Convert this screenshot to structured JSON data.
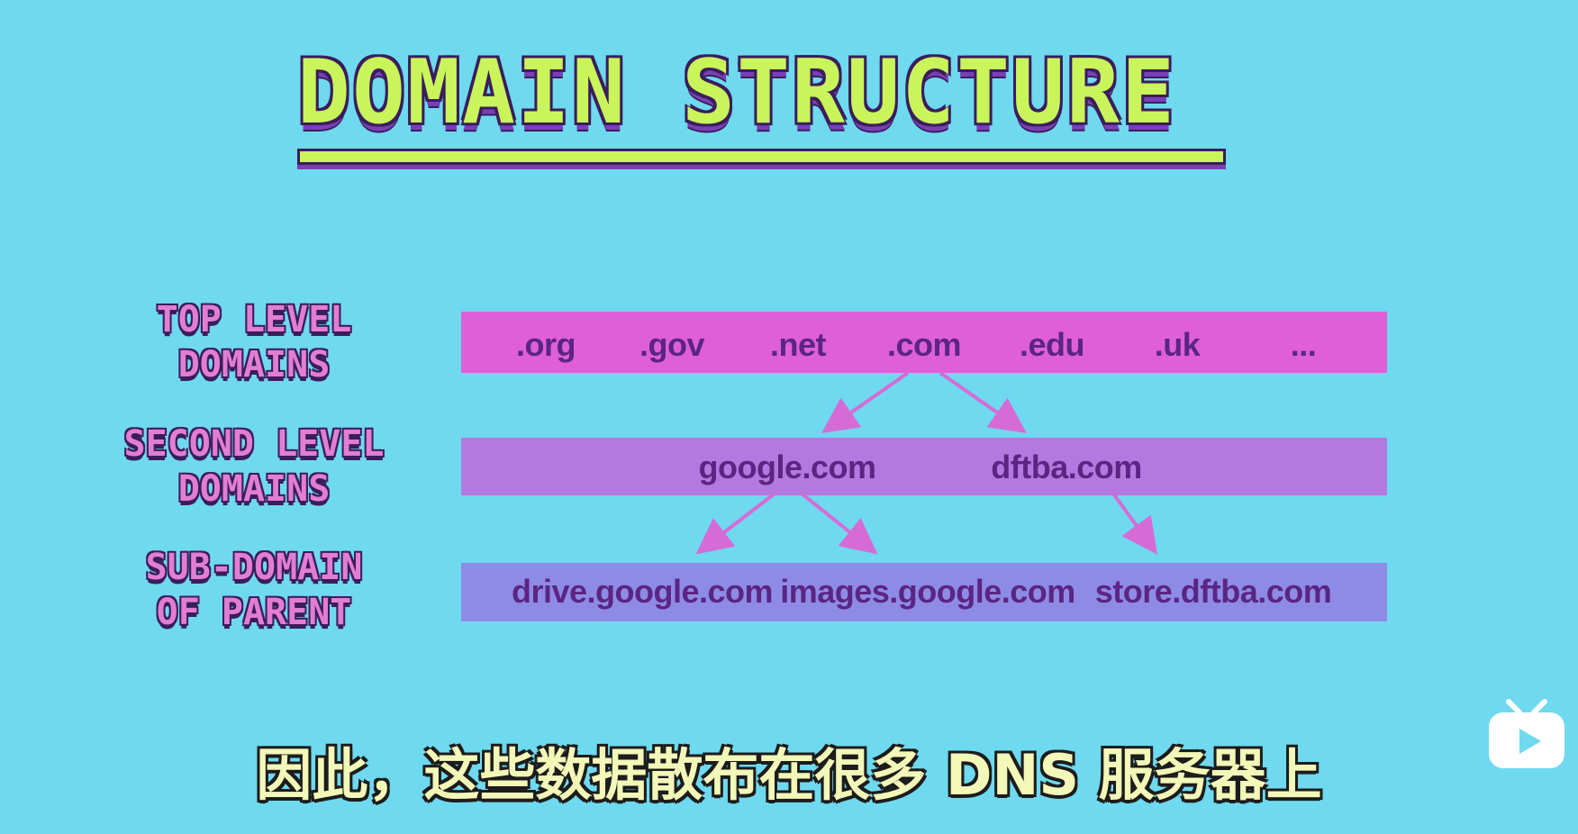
{
  "title": "DOMAIN STRUCTURE",
  "levels": {
    "top": {
      "line1": "TOP LEVEL",
      "line2": "DOMAINS"
    },
    "second": {
      "line1": "SECOND LEVEL",
      "line2": "DOMAINS"
    },
    "sub": {
      "line1": "SUB-DOMAIN",
      "line2": "OF PARENT"
    }
  },
  "top_level_domains": [
    ".org",
    ".gov",
    ".net",
    ".com",
    ".edu",
    ".uk",
    "..."
  ],
  "second_level_domains": [
    "google.com",
    "dftba.com"
  ],
  "subdomains": [
    "drive.google.com",
    "images.google.com",
    "store.dftba.com"
  ],
  "subtitle": "因此，这些数据散布在很多 DNS 服务器上",
  "logo": "bilibili-tv-icon",
  "colors": {
    "background": "#6fd9ef",
    "title": "#c9f55a",
    "top_band": "#df5fd8",
    "second_band": "#b479e0",
    "sub_band": "#8e8be7",
    "node_text": "#5b2583"
  }
}
